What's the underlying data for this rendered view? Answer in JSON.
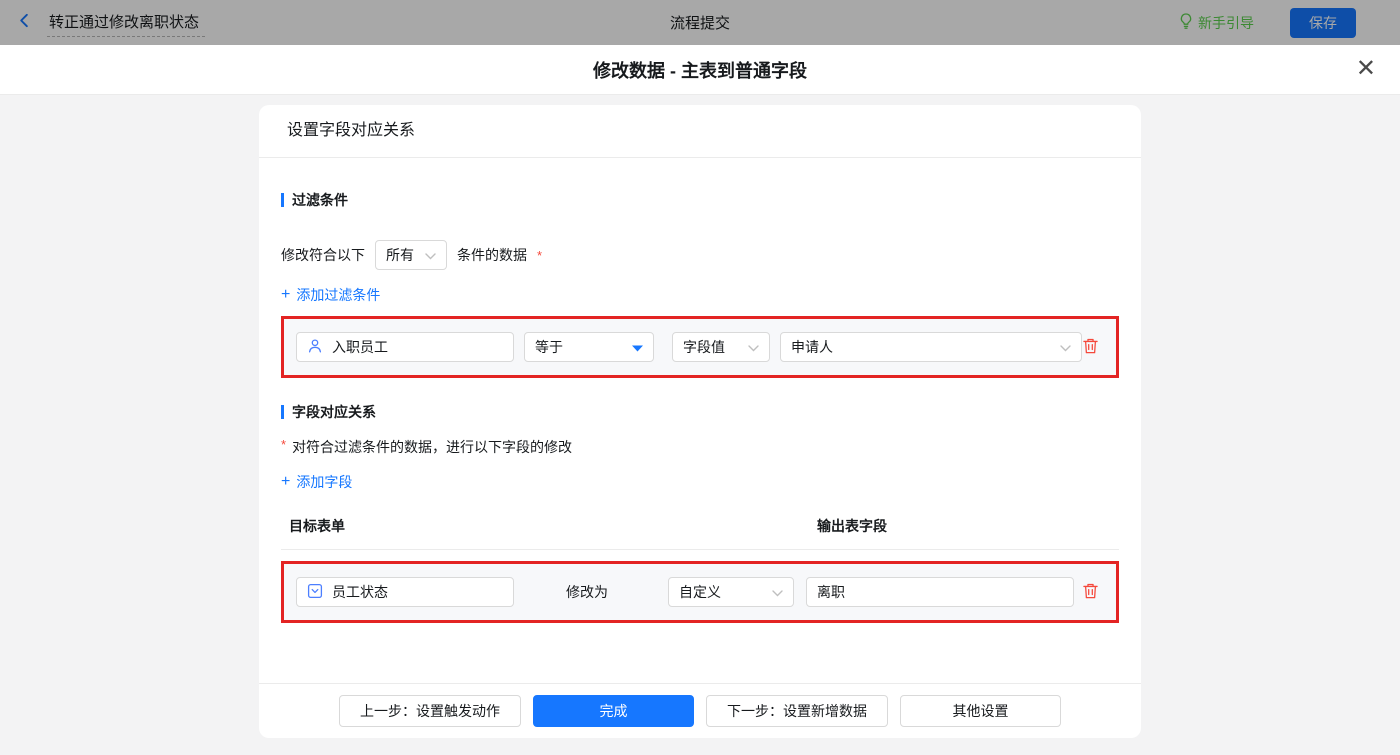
{
  "topbar": {
    "flow_name": "转正通过修改离职状态",
    "center_title": "流程提交",
    "guide_label": "新手引导",
    "save_label": "保存"
  },
  "modal": {
    "title": "修改数据 - 主表到普通字段",
    "close_glyph": "✕"
  },
  "panel": {
    "header": "设置字段对应关系",
    "filter_section": {
      "title": "过滤条件",
      "match_prefix": "修改符合以下",
      "match_select_value": "所有",
      "match_suffix": "条件的数据",
      "required_mark": "*",
      "add_plus": "+",
      "add_label": "添加过滤条件",
      "condition_row": {
        "field": "入职员工",
        "operator": "等于",
        "value_type": "字段值",
        "value": "申请人"
      }
    },
    "mapping_section": {
      "title": "字段对应关系",
      "required_mark": "*",
      "description": "对符合过滤条件的数据，进行以下字段的修改",
      "add_plus": "+",
      "add_label": "添加字段",
      "col_target": "目标表单",
      "col_output": "输出表字段",
      "row": {
        "field": "员工状态",
        "action_label": "修改为",
        "mode": "自定义",
        "value": "离职"
      }
    },
    "footer": {
      "prev_label": "上一步：设置触发动作",
      "done_label": "完成",
      "next_label": "下一步：设置新增数据",
      "other_label": "其他设置"
    }
  },
  "icons": {
    "back": "chevron-left",
    "guide": "lightbulb",
    "close": "x",
    "employee_field": "person",
    "status_field": "select-box",
    "delete": "trash",
    "select_caret": "chevron-down",
    "operator_caret": "caret-down-filled",
    "add": "plus"
  },
  "colors": {
    "primary": "#1677ff",
    "danger": "#f5483b",
    "guide_green": "#5cd14e",
    "annotation_red": "#e32423"
  }
}
